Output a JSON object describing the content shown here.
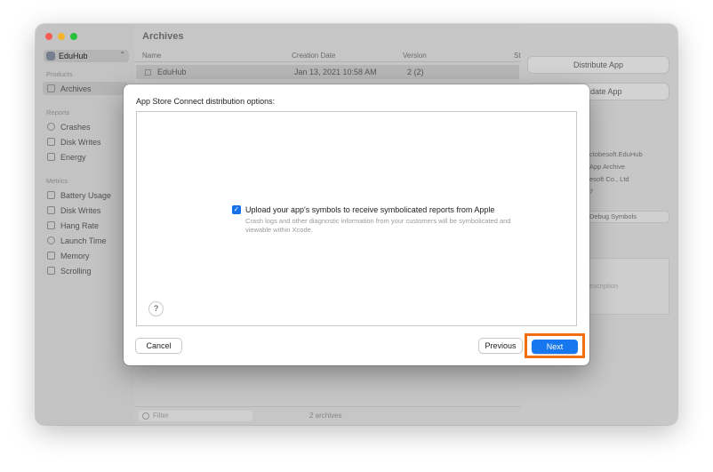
{
  "window": {
    "traffic_lights": {
      "close": "#ff5f57",
      "minimize": "#febc2e",
      "zoom": "#28c840"
    }
  },
  "sidebar": {
    "scheme": "EduHub",
    "sections": [
      {
        "title": "Products",
        "items": [
          {
            "label": "Archives",
            "icon": "archive-icon",
            "selected": true
          }
        ]
      },
      {
        "title": "Reports",
        "items": [
          {
            "label": "Crashes",
            "icon": "crash-icon"
          },
          {
            "label": "Disk Writes",
            "icon": "disk-icon"
          },
          {
            "label": "Energy",
            "icon": "energy-icon"
          }
        ]
      },
      {
        "title": "Metrics",
        "items": [
          {
            "label": "Battery Usage",
            "icon": "battery-icon"
          },
          {
            "label": "Disk Writes",
            "icon": "disk-icon"
          },
          {
            "label": "Hang Rate",
            "icon": "hourglass-icon"
          },
          {
            "label": "Launch Time",
            "icon": "clock-icon"
          },
          {
            "label": "Memory",
            "icon": "memory-icon"
          },
          {
            "label": "Scrolling",
            "icon": "scroll-icon"
          }
        ]
      }
    ]
  },
  "main": {
    "title": "Archives",
    "columns": [
      "Name",
      "Creation Date",
      "Version",
      "St"
    ],
    "rows": [
      {
        "name": "EduHub",
        "date": "Jan 13, 2021 10:58 AM",
        "version": "2 (2)"
      }
    ],
    "filter_placeholder": "Filter",
    "count": "2 archives"
  },
  "right": {
    "distribute": "Distribute App",
    "validate": "date App",
    "info": [
      "ctobesoft.EduHub",
      "App Archive",
      "esoft Co., Ltd",
      "7"
    ],
    "debug": "Debug Symbols",
    "desc": "escription"
  },
  "modal": {
    "title": "App Store Connect distribution options:",
    "option_label": "Upload your app's symbols to receive symbolicated reports from Apple",
    "option_desc": "Crash logs and other diagnostic information from your customers will be symbolicated and viewable within Xcode.",
    "option_checked": true,
    "help": "?",
    "cancel": "Cancel",
    "previous": "Previous",
    "next": "Next",
    "accent": "#1677ee",
    "highlight": "#f26f0f"
  }
}
